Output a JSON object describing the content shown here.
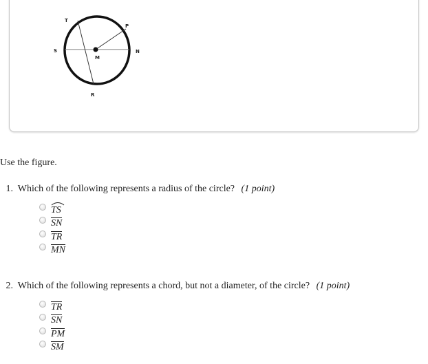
{
  "figure": {
    "points": {
      "T": "T",
      "P": "P",
      "S": "S",
      "N": "N",
      "M": "M",
      "R": "R"
    },
    "colors": {
      "stroke": "#111111",
      "chord": "#333333",
      "diameter": "#777777"
    }
  },
  "intro": "Use the figure.",
  "questions": [
    {
      "number": "1.",
      "text": "Which of the following represents a radius of the circle?",
      "points": "(1 point)",
      "options": [
        {
          "label": "TS",
          "notation": "arc"
        },
        {
          "label": "SN",
          "notation": "segment"
        },
        {
          "label": "TR",
          "notation": "segment"
        },
        {
          "label": "MN",
          "notation": "segment"
        }
      ]
    },
    {
      "number": "2.",
      "text": "Which of the following represents a chord, but not a diameter, of the circle?",
      "points": "(1 point)",
      "options": [
        {
          "label": "TR",
          "notation": "segment"
        },
        {
          "label": "SN",
          "notation": "segment"
        },
        {
          "label": "PM",
          "notation": "segment"
        },
        {
          "label": "SM",
          "notation": "segment"
        }
      ]
    }
  ]
}
